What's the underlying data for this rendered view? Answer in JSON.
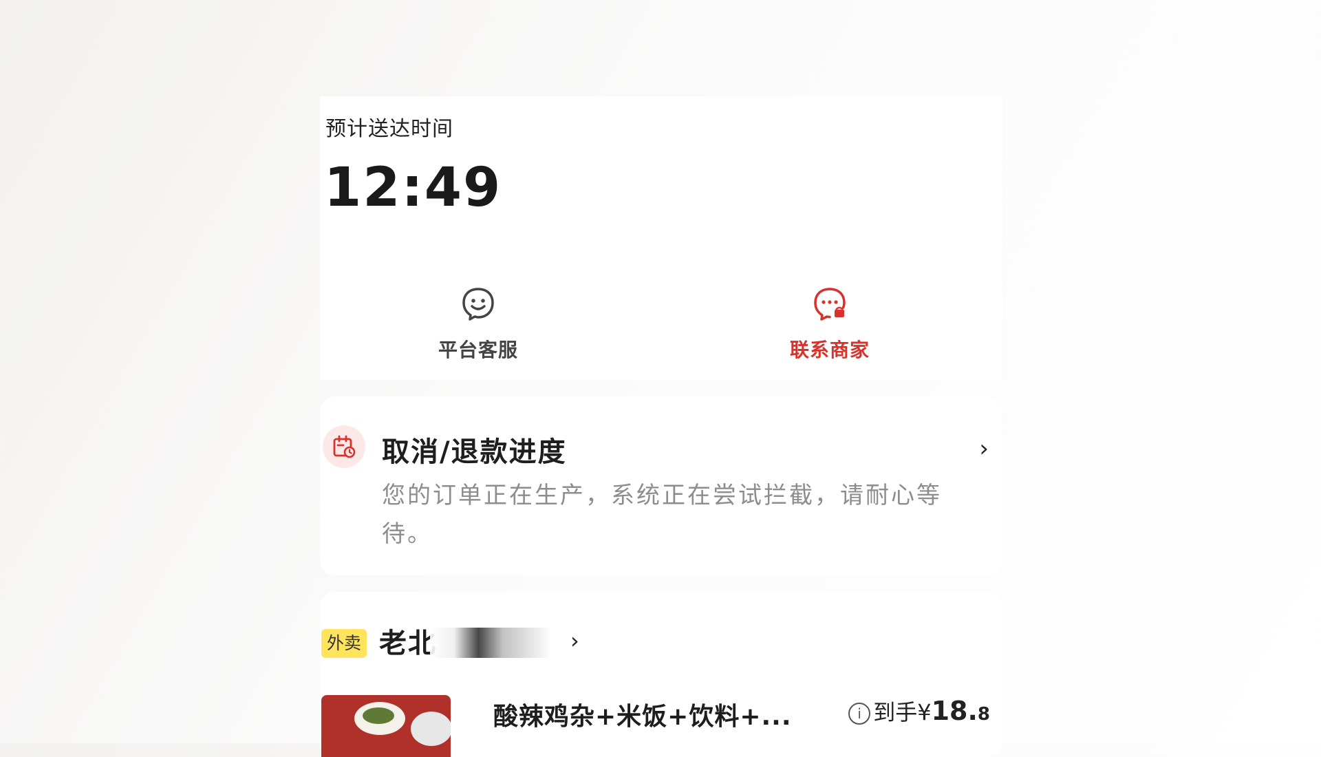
{
  "eta": {
    "label": "预计送达时间",
    "time": "12:49"
  },
  "actions": [
    {
      "label": "平台客服",
      "icon": "smiley-chat-icon",
      "color": "#444444"
    },
    {
      "label": "联系商家",
      "icon": "store-chat-icon",
      "color": "#d8322c"
    }
  ],
  "refund": {
    "icon": "refund-calendar-icon",
    "title": "取消/退款进度",
    "description": "您的订单正在生产，系统正在尝试拦截，请耐心等待。"
  },
  "order": {
    "tag": "外卖",
    "store_name": "老北",
    "item_name": "酸辣鸡杂+米饭+饮料+...",
    "price_prefix": "到手",
    "currency": "¥",
    "price_int": "18.",
    "price_dec": "8"
  },
  "colors": {
    "accent": "#d8322c",
    "tag_bg": "#ffe45c",
    "refund_icon_bg": "#fde8e8"
  }
}
